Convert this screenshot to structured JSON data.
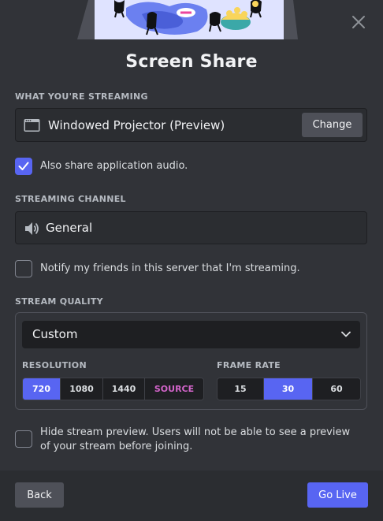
{
  "modal": {
    "title": "Screen Share"
  },
  "source": {
    "section_label": "WHAT YOU'RE STREAMING",
    "name": "Windowed Projector (Preview)",
    "change_label": "Change"
  },
  "audio": {
    "checked": true,
    "label": "Also share application audio."
  },
  "channel": {
    "section_label": "STREAMING CHANNEL",
    "name": "General"
  },
  "notify": {
    "checked": false,
    "label": "Notify my friends in this server that I'm streaming."
  },
  "quality": {
    "section_label": "STREAM QUALITY",
    "preset": "Custom",
    "resolution_label": "RESOLUTION",
    "resolutions": [
      {
        "label": "720",
        "selected": true
      },
      {
        "label": "1080",
        "selected": false
      },
      {
        "label": "1440",
        "selected": false
      },
      {
        "label": "SOURCE",
        "selected": false
      }
    ],
    "framerate_label": "FRAME RATE",
    "framerates": [
      {
        "label": "15",
        "selected": false
      },
      {
        "label": "30",
        "selected": true
      },
      {
        "label": "60",
        "selected": false
      }
    ]
  },
  "preview": {
    "checked": false,
    "label": "Hide stream preview. Users will not be able to see a preview of your stream before joining."
  },
  "footer": {
    "back_label": "Back",
    "golive_label": "Go Live"
  },
  "colors": {
    "accent": "#5865f2",
    "nitro": "#d264c9",
    "background": "#313338",
    "footer": "#2b2d31"
  },
  "icons": {
    "close": "close-icon",
    "source": "window-icon",
    "channel": "speaker-icon",
    "dropdown": "chevron-down-icon",
    "check": "checkmark-icon"
  }
}
